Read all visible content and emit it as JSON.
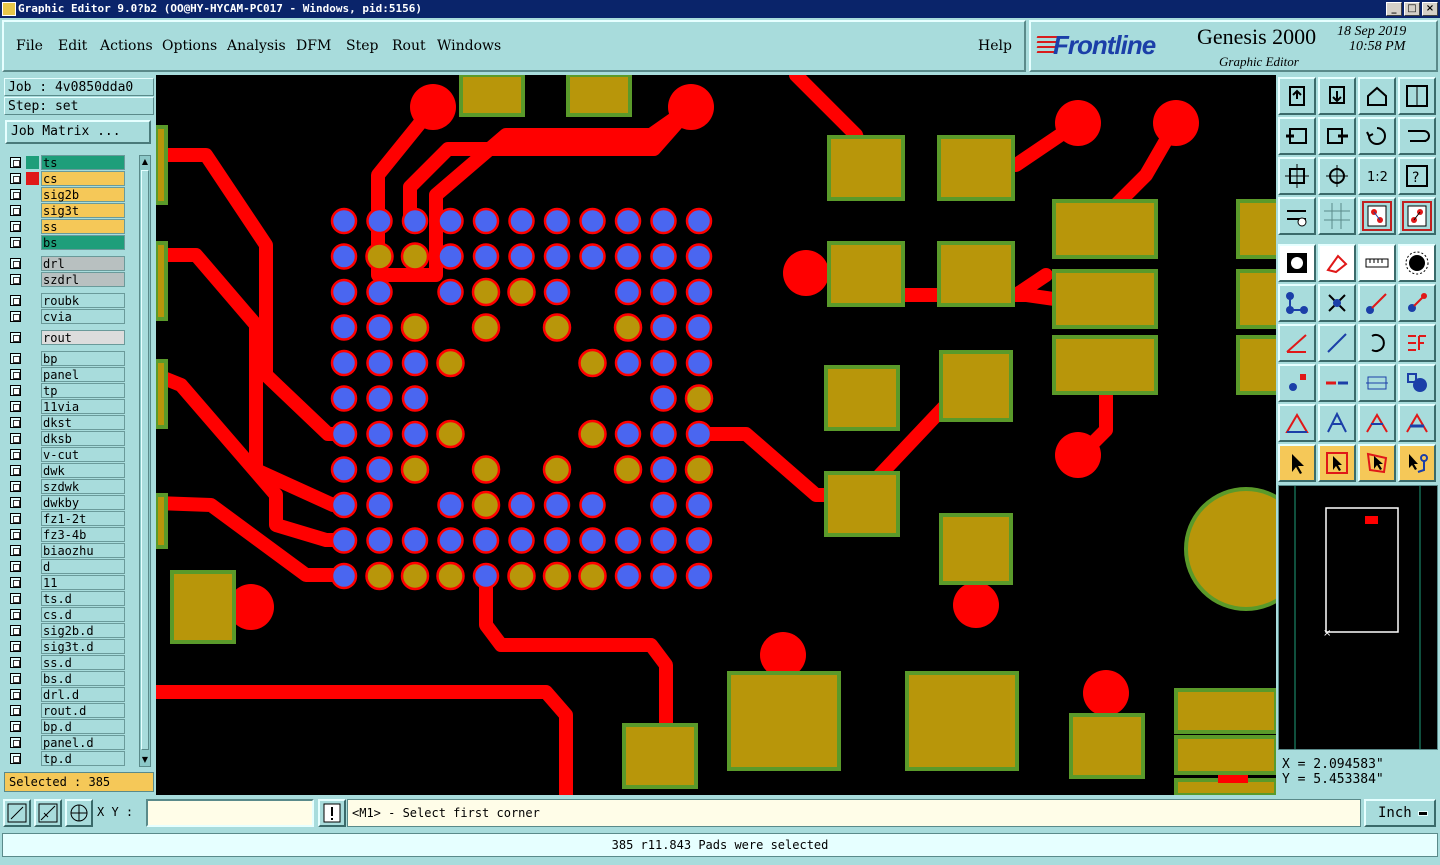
{
  "window": {
    "title": "Graphic Editor 9.0?b2 (OO@HY-HYCAM-PC017 - Windows, pid:5156)"
  },
  "menu": {
    "items": [
      {
        "label": "File"
      },
      {
        "label": "Edit"
      },
      {
        "label": "Actions"
      },
      {
        "label": "Options"
      },
      {
        "label": "Analysis"
      },
      {
        "label": "DFM"
      },
      {
        "label": "Step"
      },
      {
        "label": "Rout"
      },
      {
        "label": "Windows"
      },
      {
        "label": "Help"
      }
    ]
  },
  "brand": {
    "logo": "Frontline",
    "product": "Genesis 2000",
    "subtitle": "Graphic Editor",
    "date": "18 Sep 2019",
    "time": "10:58 PM"
  },
  "job": {
    "job_line": "Job : 4v0850dda0",
    "step_line": "Step: set",
    "matrix_button": "Job Matrix ..."
  },
  "layers": [
    {
      "name": "ts",
      "color": "#1e9e7a",
      "swatch": "#1e9e7a",
      "active": true
    },
    {
      "name": "cs",
      "color": "#f5c858",
      "swatch": "#e01818"
    },
    {
      "name": "sig2b",
      "color": "#f5c858"
    },
    {
      "name": "sig3t",
      "color": "#f5c858"
    },
    {
      "name": "ss",
      "color": "#f5c858"
    },
    {
      "name": "bs",
      "color": "#1e9e7a"
    },
    {
      "name": "drl",
      "color": "#b8c0c0"
    },
    {
      "name": "szdrl",
      "color": "#b8c0c0"
    },
    {
      "name": "roubk",
      "color": "#a8dcdc"
    },
    {
      "name": "cvia",
      "color": "#a8dcdc"
    },
    {
      "name": "rout",
      "color": "#dcdcdc"
    },
    {
      "name": "bp",
      "color": "#a8dcdc"
    },
    {
      "name": "panel",
      "color": "#a8dcdc"
    },
    {
      "name": "tp",
      "color": "#a8dcdc"
    },
    {
      "name": "11via",
      "color": "#a8dcdc"
    },
    {
      "name": "dkst",
      "color": "#a8dcdc"
    },
    {
      "name": "dksb",
      "color": "#a8dcdc"
    },
    {
      "name": "v-cut",
      "color": "#a8dcdc"
    },
    {
      "name": "dwk",
      "color": "#a8dcdc"
    },
    {
      "name": "szdwk",
      "color": "#a8dcdc"
    },
    {
      "name": "dwkby",
      "color": "#a8dcdc"
    },
    {
      "name": "fz1-2t",
      "color": "#a8dcdc"
    },
    {
      "name": "fz3-4b",
      "color": "#a8dcdc"
    },
    {
      "name": "biaozhu",
      "color": "#a8dcdc"
    },
    {
      "name": "d",
      "color": "#a8dcdc"
    },
    {
      "name": "11",
      "color": "#a8dcdc"
    },
    {
      "name": "ts.d",
      "color": "#a8dcdc"
    },
    {
      "name": "cs.d",
      "color": "#a8dcdc"
    },
    {
      "name": "sig2b.d",
      "color": "#a8dcdc"
    },
    {
      "name": "sig3t.d",
      "color": "#a8dcdc"
    },
    {
      "name": "ss.d",
      "color": "#a8dcdc"
    },
    {
      "name": "bs.d",
      "color": "#a8dcdc"
    },
    {
      "name": "drl.d",
      "color": "#a8dcdc"
    },
    {
      "name": "rout.d",
      "color": "#a8dcdc"
    },
    {
      "name": "bp.d",
      "color": "#a8dcdc"
    },
    {
      "name": "panel.d",
      "color": "#a8dcdc"
    },
    {
      "name": "tp.d",
      "color": "#a8dcdc"
    }
  ],
  "selection": {
    "label": "Selected : 385"
  },
  "coords": {
    "x": "X = 2.094583\"",
    "y": "Y = 5.453384\""
  },
  "bottom": {
    "xy_label": "X Y :",
    "xy_value": "",
    "prompt": "<M1> - Select first corner",
    "unit": "Inch"
  },
  "status": {
    "message": "385 r11.843 Pads were selected"
  },
  "colors": {
    "pad": "#b8960a",
    "pad_border": "#5a9a2a",
    "trace": "#ff0000",
    "selected_pad": "#4a66f0",
    "background": "#000000",
    "panel": "#a8dcdc"
  },
  "tool_icons": [
    "open-step-icon",
    "save-icon",
    "home-icon",
    "window-icon",
    "zoom-prev-icon",
    "zoom-next-icon",
    "undo-icon",
    "redraw-icon",
    "fit-icon",
    "zoom-in-icon",
    "one-to-one-icon",
    "help-icon",
    "snap-icon",
    "grid-icon",
    "feature-filter-icon",
    "net-select-icon",
    "pad-icon",
    "outline-icon",
    "ruler-icon",
    "circle-icon",
    "connect-icon",
    "cross-icon",
    "move-icon",
    "copy-icon",
    "measure-icon",
    "line-icon",
    "arc-icon",
    "text-icon",
    "point-icon",
    "dash-icon",
    "dimension-icon",
    "pattern-icon",
    "angle-icon",
    "arch-icon",
    "trace-icon",
    "slot-icon",
    "select-icon",
    "select-box-icon",
    "select-poly-icon",
    "route-icon"
  ]
}
